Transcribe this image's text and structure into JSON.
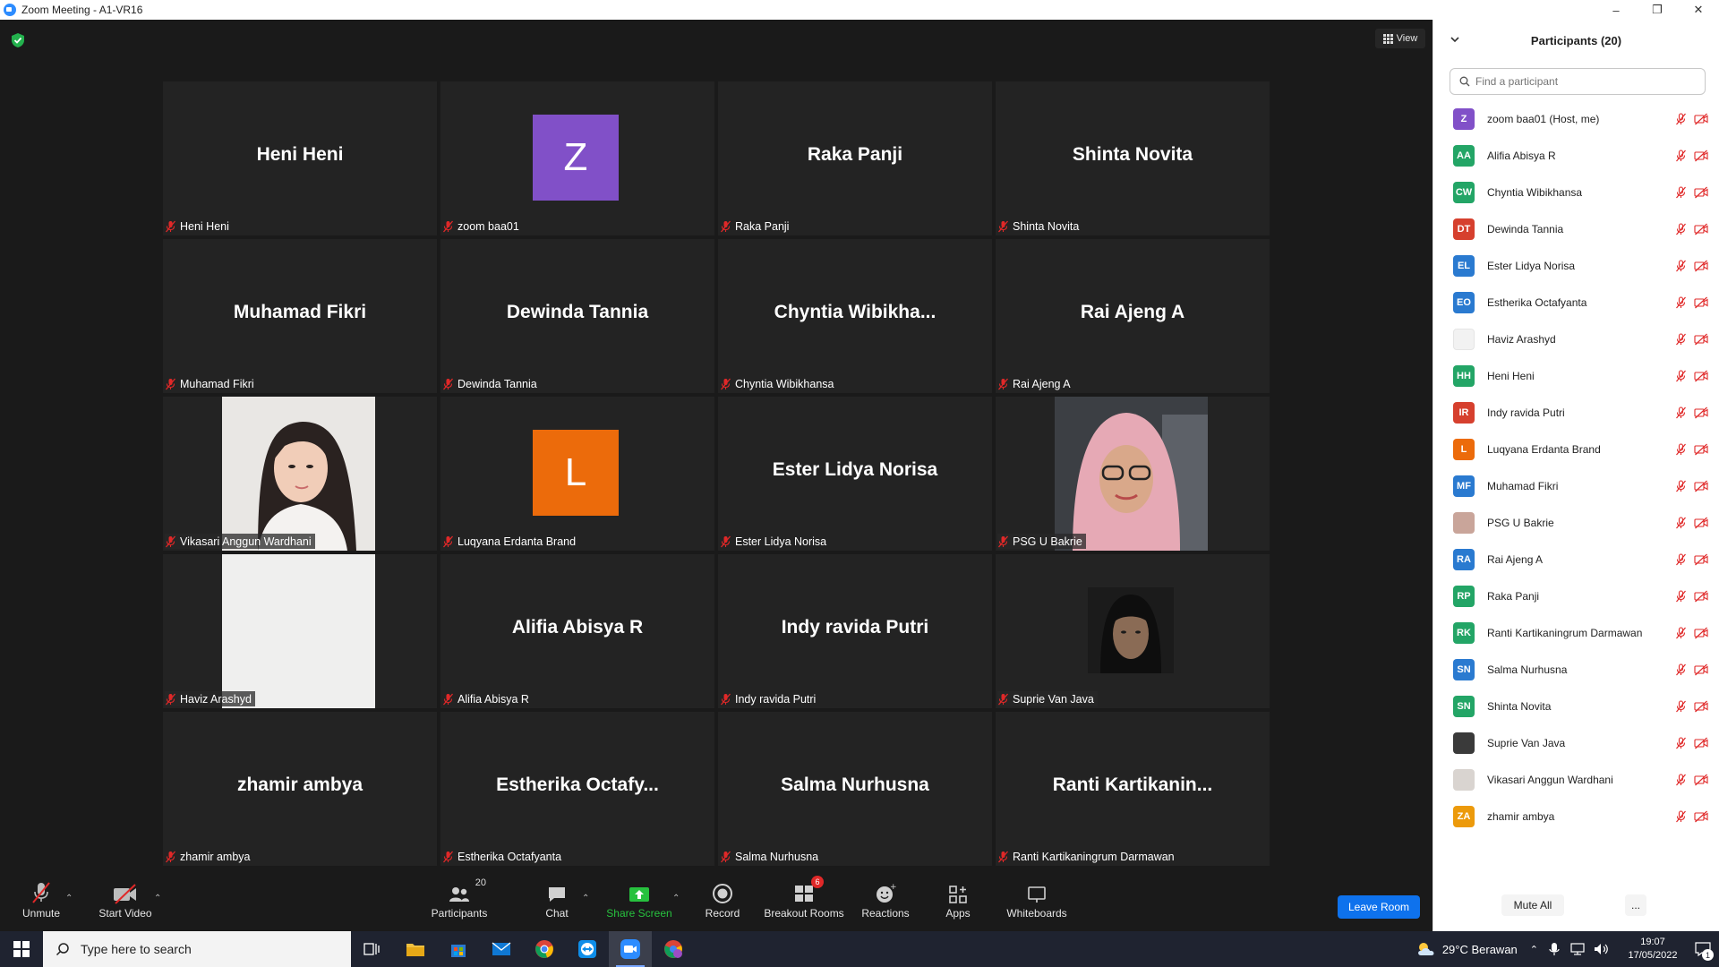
{
  "window": {
    "title": "Zoom Meeting - A1-VR16",
    "min": "–",
    "max": "❐",
    "close": "✕"
  },
  "view_label": "View",
  "tiles": [
    {
      "big": "Heni Heni",
      "label": "Heni Heni",
      "type": "name"
    },
    {
      "big": "Z",
      "label": "zoom baa01",
      "type": "avatar",
      "color": "#8150c8"
    },
    {
      "big": "Raka Panji",
      "label": "Raka Panji",
      "type": "name"
    },
    {
      "big": "Shinta Novita",
      "label": "Shinta Novita",
      "type": "name"
    },
    {
      "big": "Muhamad Fikri",
      "label": "Muhamad Fikri",
      "type": "name"
    },
    {
      "big": "Dewinda Tannia",
      "label": "Dewinda Tannia",
      "type": "name"
    },
    {
      "big": "Chyntia  Wibikha...",
      "label": "Chyntia Wibikhansa",
      "type": "name"
    },
    {
      "big": "Rai Ajeng A",
      "label": "Rai Ajeng A",
      "type": "name"
    },
    {
      "big": "",
      "label": "Vikasari Anggun Wardhani",
      "type": "photo-woman"
    },
    {
      "big": "L",
      "label": "Luqyana Erdanta Brand",
      "type": "avatar",
      "color": "#ec6b0b"
    },
    {
      "big": "Ester Lidya Norisa",
      "label": "Ester Lidya Norisa",
      "type": "name"
    },
    {
      "big": "",
      "label": "PSG U Bakrie",
      "type": "photo-hijab"
    },
    {
      "big": "",
      "label": "Haviz Arashyd",
      "type": "photo-blank"
    },
    {
      "big": "Alifia Abisya R",
      "label": "Alifia Abisya R",
      "type": "name"
    },
    {
      "big": "Indy ravida Putri",
      "label": "Indy ravida Putri",
      "type": "name"
    },
    {
      "big": "",
      "label": "Suprie Van Java",
      "type": "photo-man"
    },
    {
      "big": "zhamir ambya",
      "label": "zhamir ambya",
      "type": "name"
    },
    {
      "big": "Estherika  Octafy...",
      "label": "Estherika Octafyanta",
      "type": "name"
    },
    {
      "big": "Salma Nurhusna",
      "label": "Salma Nurhusna",
      "type": "name"
    },
    {
      "big": "Ranti  Kartikanin...",
      "label": "Ranti Kartikaningrum Darmawan",
      "type": "name"
    }
  ],
  "toolbar": {
    "unmute": "Unmute",
    "start_video": "Start Video",
    "participants": "Participants",
    "participants_count": "20",
    "chat": "Chat",
    "share_screen": "Share Screen",
    "record": "Record",
    "breakout_rooms": "Breakout Rooms",
    "breakout_badge": "6",
    "reactions": "Reactions",
    "apps": "Apps",
    "whiteboards": "Whiteboards",
    "leave_room": "Leave Room"
  },
  "panel": {
    "title": "Participants (20)",
    "search_placeholder": "Find a participant",
    "mute_all": "Mute All",
    "more": "...",
    "participants": [
      {
        "initials": "Z",
        "name": "zoom baa01 (Host, me)",
        "color": "#8150c8"
      },
      {
        "initials": "AA",
        "name": "Alifia Abisya R",
        "color": "#23a566"
      },
      {
        "initials": "CW",
        "name": "Chyntia Wibikhansa",
        "color": "#23a566"
      },
      {
        "initials": "DT",
        "name": "Dewinda Tannia",
        "color": "#d6402e"
      },
      {
        "initials": "EL",
        "name": "Ester Lidya Norisa",
        "color": "#2a7ad0"
      },
      {
        "initials": "EO",
        "name": "Estherika Octafyanta",
        "color": "#2a7ad0"
      },
      {
        "initials": "",
        "name": "Haviz Arashyd",
        "color": "#f2f2f2"
      },
      {
        "initials": "HH",
        "name": "Heni Heni",
        "color": "#23a566"
      },
      {
        "initials": "IR",
        "name": "Indy ravida Putri",
        "color": "#d6402e"
      },
      {
        "initials": "L",
        "name": "Luqyana Erdanta Brand",
        "color": "#ec6b0b"
      },
      {
        "initials": "MF",
        "name": "Muhamad Fikri",
        "color": "#2a7ad0"
      },
      {
        "initials": "",
        "name": "PSG U Bakrie",
        "color": "#c9a59a"
      },
      {
        "initials": "RA",
        "name": "Rai Ajeng A",
        "color": "#2a7ad0"
      },
      {
        "initials": "RP",
        "name": "Raka Panji",
        "color": "#23a566"
      },
      {
        "initials": "RK",
        "name": "Ranti Kartikaningrum Darmawan",
        "color": "#23a566"
      },
      {
        "initials": "SN",
        "name": "Salma Nurhusna",
        "color": "#2a7ad0"
      },
      {
        "initials": "SN",
        "name": "Shinta Novita",
        "color": "#23a566"
      },
      {
        "initials": "",
        "name": "Suprie Van Java",
        "color": "#3a3a3a"
      },
      {
        "initials": "",
        "name": "Vikasari Anggun Wardhani",
        "color": "#d9d4d0"
      },
      {
        "initials": "ZA",
        "name": "zhamir ambya",
        "color": "#ec9a0b"
      }
    ]
  },
  "taskbar": {
    "search_placeholder": "Type here to search",
    "weather": "29°C  Berawan",
    "time": "19:07",
    "date": "17/05/2022",
    "notif_count": "1"
  },
  "colors": {
    "accent": "#0e72ed",
    "mic_off": "#e02828",
    "share_green": "#27c13e"
  }
}
